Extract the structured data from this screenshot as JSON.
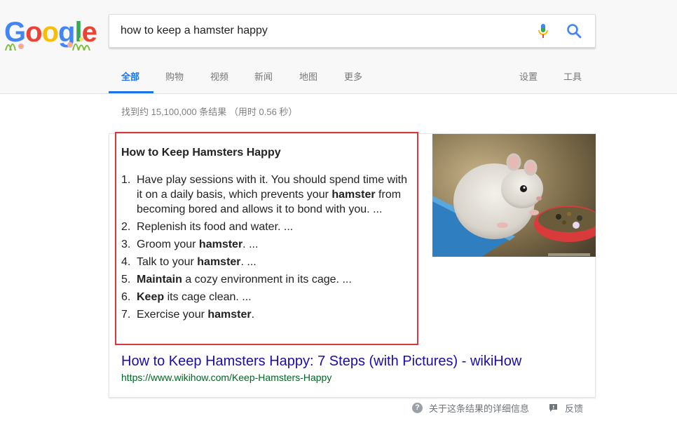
{
  "logo": {
    "letters": [
      "G",
      "o",
      "o",
      "g",
      "l",
      "e"
    ]
  },
  "search": {
    "query": "how to keep a hamster happy"
  },
  "icons": {
    "mic": "microphone-icon",
    "search": "search-icon",
    "help": "question-circle-icon",
    "feedback": "feedback-flag-icon"
  },
  "tabs": {
    "all": "全部",
    "shopping": "购物",
    "videos": "视频",
    "news": "新闻",
    "maps": "地图",
    "more": "更多",
    "settings": "设置",
    "tools": "工具"
  },
  "stats": "找到约 15,100,000 条结果 （用时 0.56 秒）",
  "snippet": {
    "title": "How to Keep Hamsters Happy",
    "steps": [
      {
        "num": "1.",
        "parts": [
          "Have play sessions with it. You should spend time with it on a daily basis, which prevents your ",
          "hamster",
          " from becoming bored and allows it to bond with you. ..."
        ]
      },
      {
        "num": "2.",
        "parts": [
          "Replenish its food and water. ..."
        ]
      },
      {
        "num": "3.",
        "parts": [
          "Groom your ",
          "hamster",
          ". ..."
        ]
      },
      {
        "num": "4.",
        "parts": [
          "Talk to your ",
          "hamster",
          ". ..."
        ]
      },
      {
        "num": "5.",
        "parts": [
          "",
          "Maintain",
          " a cozy environment in its cage. ..."
        ]
      },
      {
        "num": "6.",
        "parts": [
          "",
          "Keep",
          " its cage clean. ..."
        ]
      },
      {
        "num": "7.",
        "parts": [
          "Exercise your ",
          "hamster",
          "."
        ]
      }
    ]
  },
  "result": {
    "link": "How to Keep Hamsters Happy: 7 Steps (with Pictures) - wikiHow",
    "url": "https://www.wikihow.com/Keep-Hamsters-Happy"
  },
  "footer": {
    "about": "关于这条结果的详细信息",
    "feedback": "反馈"
  },
  "colors": {
    "accent": "#1a73e8",
    "link": "#1a0dab",
    "url": "#006621",
    "highlight": "#d9393e"
  }
}
